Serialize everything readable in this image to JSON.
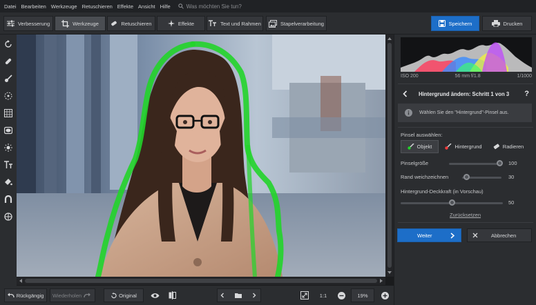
{
  "menu": {
    "items": [
      "Datei",
      "Bearbeiten",
      "Werkzeuge",
      "Retuschieren",
      "Effekte",
      "Ansicht",
      "Hilfe"
    ],
    "search_placeholder": "Was möchten Sie tun?"
  },
  "toolbar": {
    "tabs": [
      {
        "label": "Verbesserung",
        "icon": "sliders-icon"
      },
      {
        "label": "Werkzeuge",
        "icon": "crop-icon",
        "active": true
      },
      {
        "label": "Retuschieren",
        "icon": "retouch-icon"
      },
      {
        "label": "Effekte",
        "icon": "sparkle-icon"
      },
      {
        "label": "Text und Rahmen",
        "icon": "text-icon"
      },
      {
        "label": "Stapelverarbeitung",
        "icon": "batch-icon"
      }
    ],
    "save_label": "Speichern",
    "print_label": "Drucken"
  },
  "histogram": {
    "iso": "ISO 200",
    "lens": "56 mm f/1.8",
    "shutter": "1/1000"
  },
  "panel": {
    "title": "Hintergrund ändern: Schritt 1 von 3",
    "help": "?",
    "info_text": "Wählen Sie den \"Hintergrund\"-Pinsel aus.",
    "brush_select_label": "Pinsel auswählen:",
    "brush_object": "Objekt",
    "brush_background": "Hintergrund",
    "brush_erase": "Radieren",
    "brush_size_label": "Pinselgröße",
    "brush_size_value": "100",
    "feather_label": "Rand weichzeichnen",
    "feather_value": "30",
    "opacity_label": "Hintergrund-Deckkraft (in Vorschau)",
    "opacity_value": "50",
    "reset_label": "Zurücksetzen",
    "next_label": "Weiter",
    "cancel_label": "Abbrechen"
  },
  "bottom": {
    "undo_label": "Rückgängig",
    "redo_label": "Wiederholen",
    "original_label": "Original",
    "ratio_label": "1:1",
    "zoom_value": "19%"
  },
  "colors": {
    "accent": "#1d6ec8",
    "selection_stroke": "#22d42a"
  }
}
